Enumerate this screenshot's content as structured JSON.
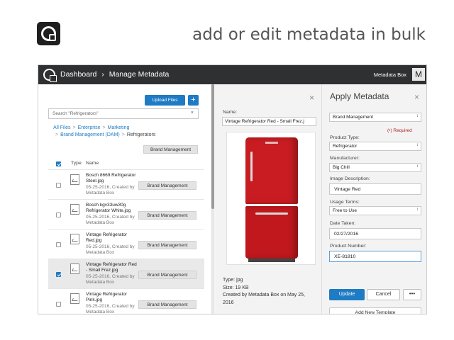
{
  "slide": {
    "title": "add or edit metadata in bulk"
  },
  "topbar": {
    "breadcrumb": [
      "Dashboard",
      "Manage Metadata"
    ],
    "separator": "›",
    "brand": "Metadata Box",
    "avatar_letter": "M"
  },
  "files": {
    "upload_label": "Upload Files",
    "add_label": "+",
    "search_placeholder": "Search \"Refrigerators\"",
    "clear_label": "×",
    "path": [
      "All Files",
      "Enterprise",
      "Marketing",
      "Brand Management (DAM)",
      "Refrigerators"
    ],
    "path_sep": ">",
    "folder_tag": "Brand Management",
    "columns": [
      "Type",
      "Name"
    ],
    "rows": [
      {
        "name": "Bosch 8669 Refrigerator Steel.jpg",
        "meta": "05-25-2016, Created by Metadata Box",
        "tag": "Brand Management",
        "checked": false
      },
      {
        "name": "Bosch kgv33uw30g Refrigerator White.jpg",
        "meta": "05-25-2016, Created by Metadata Box",
        "tag": "Brand Management",
        "checked": false
      },
      {
        "name": "Vintage Refrigerator Red.jpg",
        "meta": "05-25-2016, Created by Metadata Box",
        "tag": "Brand Management",
        "checked": false
      },
      {
        "name": "Vintage Refrigerator Red - Small Frez.jpg",
        "meta": "05-25-2016, Created by Metadata Box",
        "tag": "Brand Management",
        "checked": true
      },
      {
        "name": "Vintage Refrigerator Pink.jpg",
        "meta": "05-25-2016, Created by Metadata Box",
        "tag": "Brand Management",
        "checked": false
      }
    ]
  },
  "preview": {
    "close_label": "×",
    "name_label": "Name:",
    "name_value": "Vintage Refrigerator Red - Small Frez.j",
    "type": "Type: jpg",
    "size": "Size: 19 KB",
    "created": "Created by Metadata Box on May 25, 2016"
  },
  "metadata": {
    "title": "Apply Metadata",
    "close_label": "×",
    "template": "Brand Management",
    "required_note": "(•) Required",
    "product_type_label": "Product Type:",
    "product_type": "Refrigerator",
    "manufacturer_label": "Manufacturer:",
    "manufacturer": "Big Chill",
    "image_desc_label": "Image Description:",
    "image_desc": "Vintage Red",
    "usage_terms_label": "Usage Terms:",
    "usage_terms": "Free to Use",
    "date_taken_label": "Date Taken:",
    "date_taken": "02/27/2016",
    "product_number_label": "Product Number:",
    "product_number": "XE-81810",
    "update_label": "Update",
    "cancel_label": "Cancel",
    "more_label": "•••",
    "add_template_label": "Add New Template",
    "arrow": "↕"
  },
  "colors": {
    "accent": "#1e7bc4",
    "topbar": "#2f3032",
    "required": "#b02020",
    "fridge": "#c81c22"
  }
}
